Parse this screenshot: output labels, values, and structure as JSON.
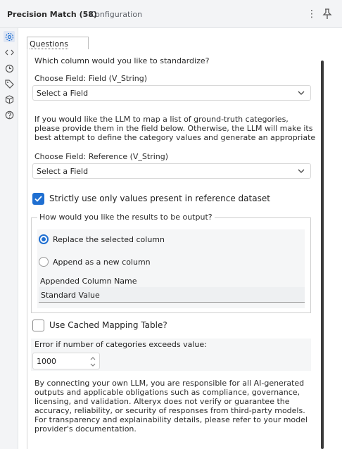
{
  "titlebar": {
    "title": "Precision Match (58)",
    "subtitle": "- Configuration",
    "menu_glyph": "⋮"
  },
  "sidebar": {
    "icons": [
      "gear-icon",
      "code-icon",
      "history-icon",
      "tag-icon",
      "cube-icon",
      "help-icon"
    ]
  },
  "tabs": {
    "questions_label": "Questions"
  },
  "form": {
    "question": "Which column would you like to standardize?",
    "field1_label": "Choose Field: Field (V_String)",
    "field1_value": "Select a Field",
    "intro_paragraph": "If you would like the LLM to map a list of ground-truth categories, please provide them in the field below. Otherwise, the LLM will make its best attempt to define the category values and generate an appropriate",
    "field2_label": "Choose Field: Reference (V_String)",
    "field2_value": "Select a Field",
    "strict_label": "Strictly use only values present in reference dataset",
    "strict_checked": true,
    "output_group": {
      "legend": "How would you like the results to be output?",
      "option_replace": "Replace the selected column",
      "option_append": "Append as a new column",
      "selected": "replace",
      "appended_name_label": "Appended Column Name",
      "appended_name_value": "Standard Value"
    },
    "cached_label": "Use Cached Mapping Table?",
    "cached_checked": false,
    "error_label": "Error if number of categories exceeds value:",
    "error_value": "1000",
    "disclaimer": "By connecting your own LLM, you are responsible for all AI-generated outputs and applicable obligations such as compliance, governance, licensing, and validation. Alteryx does not verify or guarantee the accuracy, reliability, or security of responses from third-party models. For transparency and explainability details, please refer to your model provider's documentation."
  },
  "colors": {
    "accent": "#1f6fd1",
    "chrome": "#f3f4f6"
  }
}
